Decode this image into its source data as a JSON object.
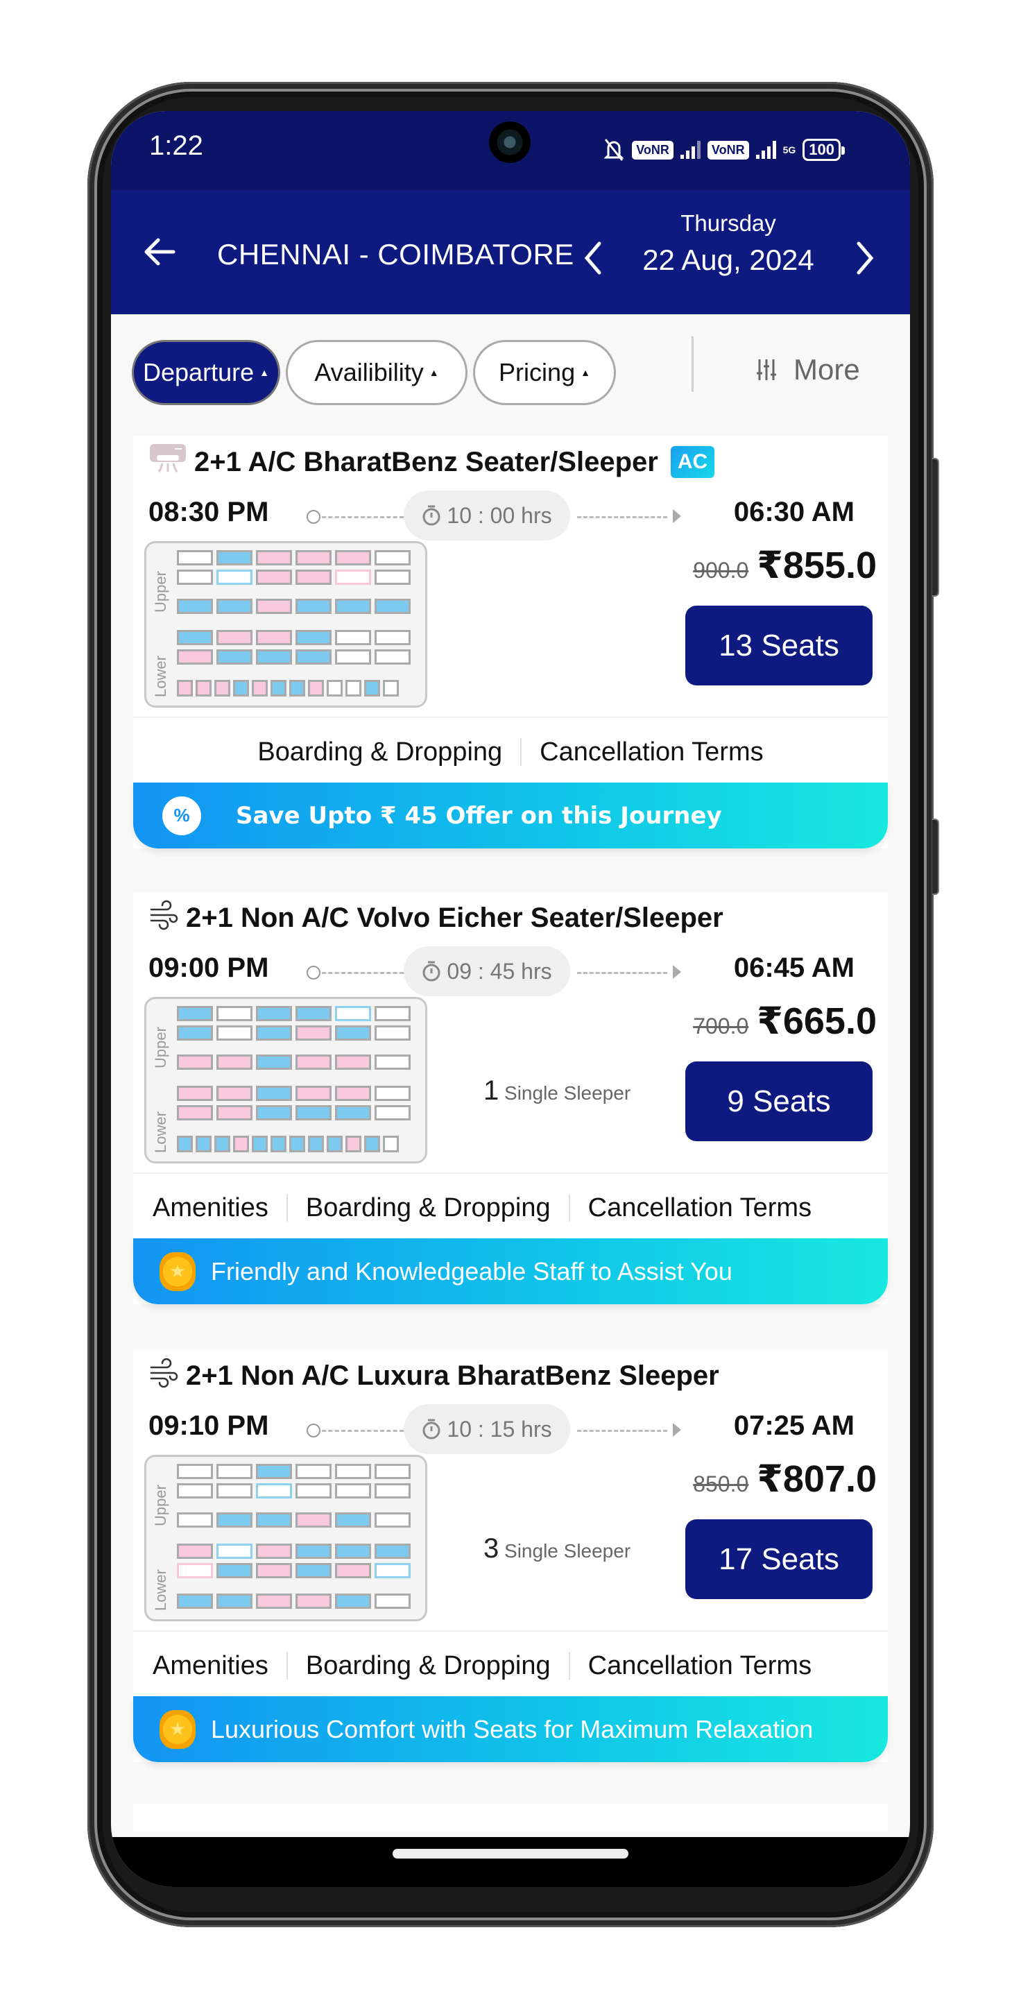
{
  "status_bar": {
    "time": "1:22",
    "icons": [
      "bell-off-icon",
      "vonr-badge",
      "signal-icon",
      "vonr-badge",
      "signal-icon",
      "5g-icon",
      "battery-icon"
    ],
    "vonr_label": "VoNR",
    "network": "5G",
    "battery": "100"
  },
  "header": {
    "route": "CHENNAI - COIMBATORE",
    "day": "Thursday",
    "date": "22 Aug, 2024"
  },
  "filters": {
    "chips": [
      {
        "label": "Departure",
        "active": true
      },
      {
        "label": "Availibility",
        "active": false
      },
      {
        "label": "Pricing",
        "active": false
      }
    ],
    "more_label": "More"
  },
  "colors": {
    "brand": "#0e1a80",
    "status_bar": "#0b1466",
    "seat_blue": "#7ccaf0",
    "seat_pink": "#f8c8dc",
    "promo_start": "#1394f4",
    "promo_end": "#18e8e0"
  },
  "buses": [
    {
      "title": "2+1 A/C BharatBenz Seater/Sleeper",
      "icon": "ac-icon",
      "ac_badge": "AC",
      "departure": "08:30 PM",
      "arrival": "06:30 AM",
      "duration": "10 : 00 hrs",
      "single_sleeper_count": null,
      "single_sleeper_label": null,
      "old_price": "900.0",
      "price": "₹855.0",
      "seats_label": "13 Seats",
      "links": [
        "Boarding & Dropping",
        "Cancellation Terms"
      ],
      "promo": {
        "icon": "offer-percent-icon",
        "text": "Save Upto ₹ 45 Offer on this Journey"
      },
      "seatmap": {
        "upper_label": "Upper",
        "lower_label": "Lower",
        "upper": [
          [
            "W",
            "B",
            "P",
            "P",
            "P",
            "W"
          ],
          [
            "W",
            "Wb",
            "P",
            "P",
            "Wp",
            "W"
          ],
          [
            "B",
            "B",
            "P",
            "B",
            "B",
            "B"
          ]
        ],
        "lower": [
          [
            "B",
            "P",
            "P",
            "B",
            "W",
            "W"
          ],
          [
            "P",
            "B",
            "B",
            "B",
            "W",
            "W"
          ]
        ],
        "lower_single": [
          "P",
          "P",
          "P",
          "B",
          "P",
          "B",
          "B",
          "P",
          "W",
          "W",
          "B",
          "W"
        ],
        "lower_single_small": true
      }
    },
    {
      "title": "2+1 Non A/C Volvo Eicher Seater/Sleeper",
      "icon": "fan-wind-icon",
      "ac_badge": null,
      "departure": "09:00 PM",
      "arrival": "06:45 AM",
      "duration": "09 : 45 hrs",
      "single_sleeper_count": "1",
      "single_sleeper_label": "Single Sleeper",
      "old_price": "700.0",
      "price": "₹665.0",
      "seats_label": "9 Seats",
      "links": [
        "Amenities",
        "Boarding & Dropping",
        "Cancellation Terms"
      ],
      "promo": {
        "icon": "gold-badge-icon",
        "text": "Friendly and Knowledgeable Staff to Assist You"
      },
      "seatmap": {
        "upper_label": "Upper",
        "lower_label": "Lower",
        "upper": [
          [
            "B",
            "W",
            "B",
            "B",
            "Wb",
            "W"
          ],
          [
            "B",
            "W",
            "B",
            "P",
            "B",
            "W"
          ],
          [
            "P",
            "P",
            "B",
            "P",
            "P",
            "W"
          ]
        ],
        "lower": [
          [
            "P",
            "P",
            "B",
            "P",
            "P",
            "W"
          ],
          [
            "P",
            "P",
            "B",
            "B",
            "B",
            "W"
          ]
        ],
        "lower_single": [
          "B",
          "B",
          "B",
          "P",
          "B",
          "B",
          "B",
          "B",
          "B",
          "P",
          "B",
          "W"
        ],
        "lower_single_small": true
      }
    },
    {
      "title": "2+1 Non A/C Luxura BharatBenz Sleeper",
      "icon": "fan-wind-icon",
      "ac_badge": null,
      "departure": "09:10 PM",
      "arrival": "07:25 AM",
      "duration": "10 : 15 hrs",
      "single_sleeper_count": "3",
      "single_sleeper_label": "Single Sleeper",
      "old_price": "850.0",
      "price": "₹807.0",
      "seats_label": "17 Seats",
      "links": [
        "Amenities",
        "Boarding & Dropping",
        "Cancellation Terms"
      ],
      "promo": {
        "icon": "gold-badge-icon",
        "text": "Luxurious Comfort with Seats for Maximum Relaxation"
      },
      "seatmap": {
        "upper_label": "Upper",
        "lower_label": "Lower",
        "upper": [
          [
            "W",
            "W",
            "B",
            "W",
            "W",
            "W"
          ],
          [
            "W",
            "W",
            "Wb",
            "W",
            "W",
            "W"
          ],
          [
            "W",
            "B",
            "B",
            "P",
            "B",
            "W"
          ]
        ],
        "lower": [
          [
            "P",
            "Wb",
            "P",
            "B",
            "B",
            "B"
          ],
          [
            "Wp",
            "B",
            "P",
            "B",
            "P",
            "Wb"
          ]
        ],
        "lower_single": [
          "B",
          "B",
          "P",
          "P",
          "B",
          "W"
        ],
        "lower_single_small": false
      }
    }
  ]
}
